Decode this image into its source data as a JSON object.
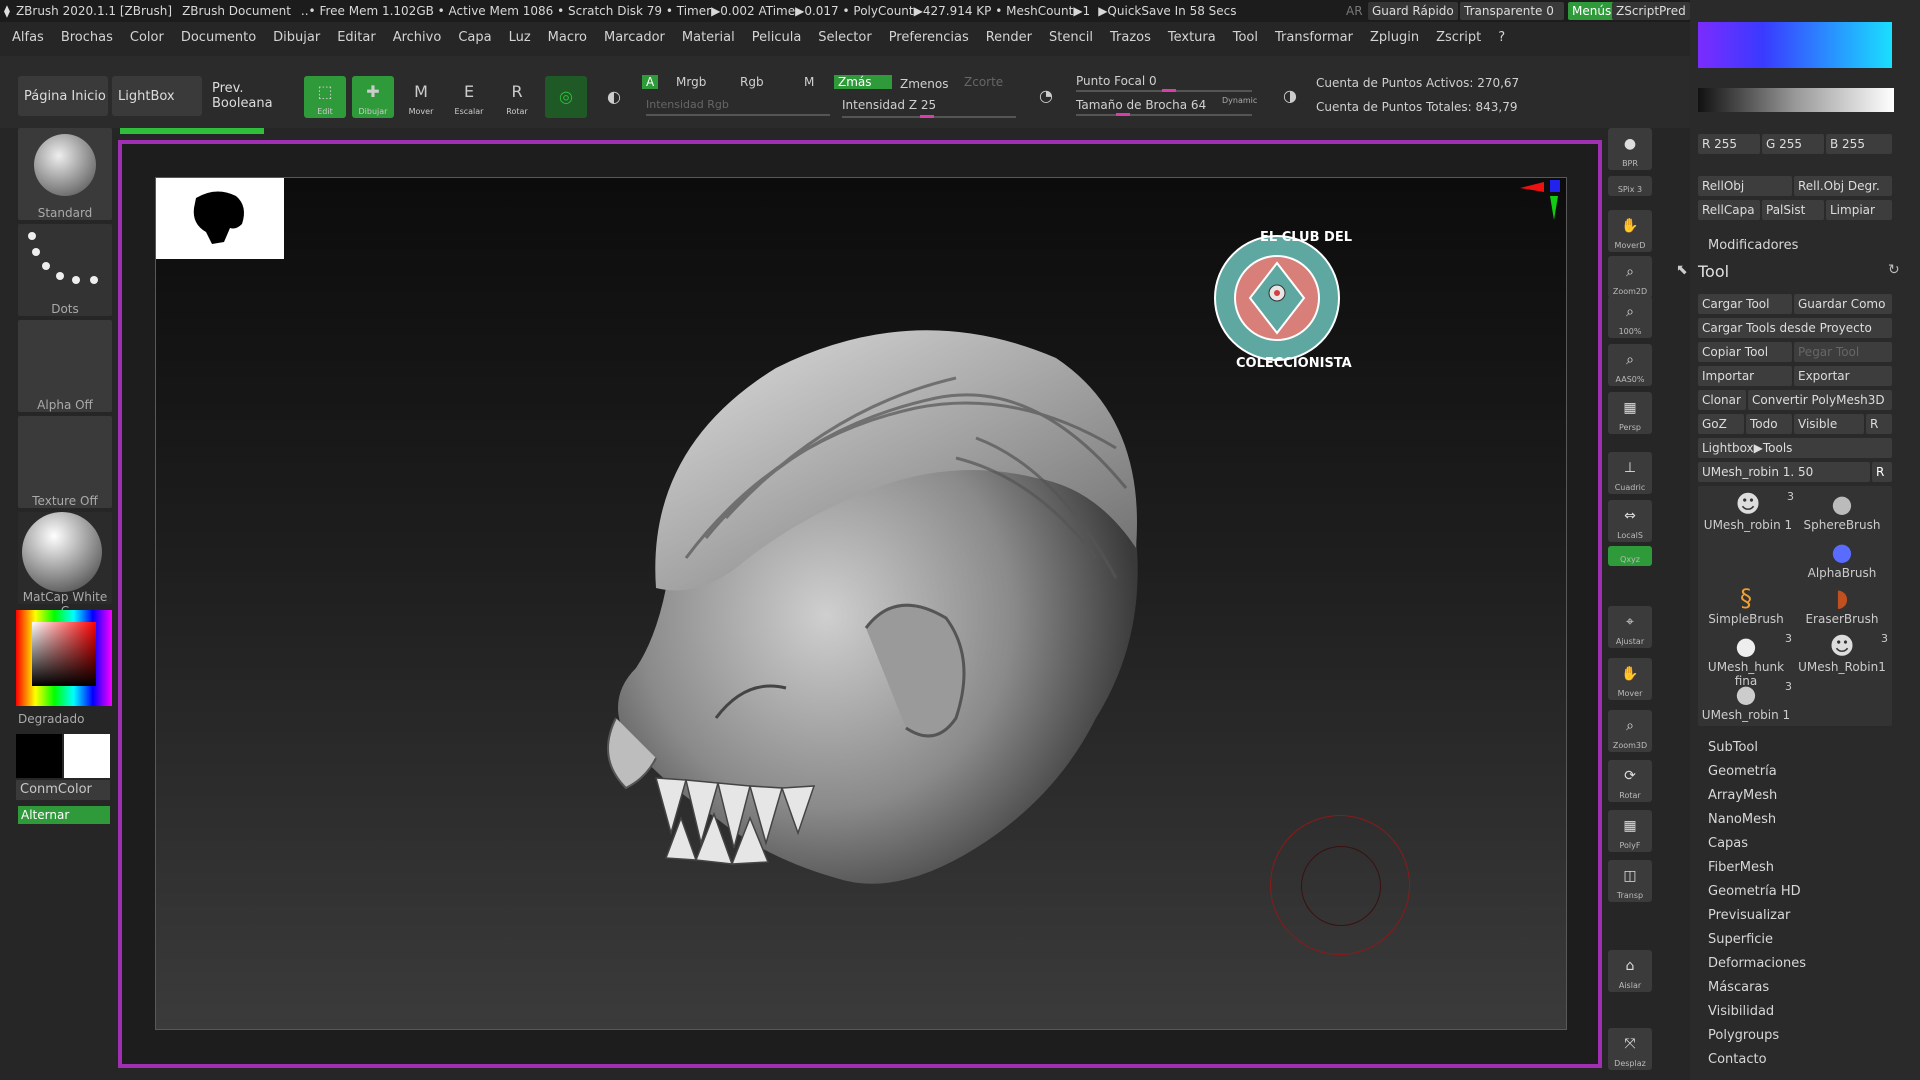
{
  "titlebar": {
    "logo_icon": "zbrush-logo",
    "app": "ZBrush 2020.1.1 [ZBrush]",
    "doc": "ZBrush Document",
    "stats": "..• Free Mem 1.102GB • Active Mem 1086 • Scratch Disk 79 • Timer▶0.002 ATime▶0.017 • PolyCount▶427.914 KP • MeshCount▶1",
    "quicksave": "▶QuickSave In 58 Secs",
    "ar": "AR",
    "guard_rapido": "Guard Rápido",
    "transparente": "Transparente 0",
    "menus": "Menús",
    "zscript": "ZScriptPred",
    "accent": "#2f9a3a"
  },
  "menu": [
    "Alfas",
    "Brochas",
    "Color",
    "Documento",
    "Dibujar",
    "Editar",
    "Archivo",
    "Capa",
    "Luz",
    "Macro",
    "Marcador",
    "Material",
    "Pelicula",
    "Selector",
    "Preferencias",
    "Render",
    "Stencil",
    "Trazos",
    "Textura",
    "Tool",
    "Transformar",
    "Zplugin",
    "Zscript",
    "?"
  ],
  "shelf": {
    "pagina_inicio": "Página Inicio",
    "lightbox": "LightBox",
    "prev_booleana": "Prev. Booleana",
    "edit": "Edit",
    "dibujar": "Dibujar",
    "mover": "Mover",
    "escalar": "Escalar",
    "rotar": "Rotar",
    "a": "A",
    "mrgb": "Mrgb",
    "rgb": "Rgb",
    "m": "M",
    "zmas": "Zmás",
    "zmenos": "Zmenos",
    "zcorte": "Zcorte",
    "intensidad_rgb": "Intensidad Rgb",
    "intensidad_z": "Intensidad Z 25",
    "punto_focal": "Punto Focal 0",
    "tamano_brocha": "Tamaño de Brocha 64",
    "dynamic": "Dynamic",
    "cuenta_activos": "Cuenta de Puntos Activos: 270,67",
    "cuenta_totales": "Cuenta de Puntos Totales: 843,79"
  },
  "left": {
    "standard": "Standard",
    "dots": "Dots",
    "alpha_off": "Alpha Off",
    "texture_off": "Texture Off",
    "matcap": "MatCap White C",
    "degradado": "Degradado",
    "conmcolor": "ConmColor",
    "alternar": "Alternar"
  },
  "canvas": {
    "logo_top": "EL CLUB DEL",
    "logo_bottom": "COLECCIONISTA",
    "logo_ring_color": "#5fa8a2",
    "logo_inner_color": "#d97f7a"
  },
  "rightshelf": [
    {
      "name": "bpr",
      "label": "BPR"
    },
    {
      "name": "spix",
      "label": "SPix 3"
    },
    {
      "name": "moverd",
      "label": "MoverD"
    },
    {
      "name": "zoom2d",
      "label": "Zoom2D"
    },
    {
      "name": "z100",
      "label": "100%"
    },
    {
      "name": "aahalf",
      "label": "AAS0%"
    },
    {
      "name": "persp",
      "label": "Persp"
    },
    {
      "name": "cuadric",
      "label": "Cuadric"
    },
    {
      "name": "locals",
      "label": "LocalS"
    },
    {
      "name": "xyz",
      "label": "Qxyz"
    },
    {
      "name": "ajustar",
      "label": "Ajustar"
    },
    {
      "name": "mover",
      "label": "Mover"
    },
    {
      "name": "zoom3d",
      "label": "Zoom3D"
    },
    {
      "name": "rotar",
      "label": "Rotar"
    },
    {
      "name": "polyf",
      "label": "PolyF"
    },
    {
      "name": "transp",
      "label": "Transp"
    },
    {
      "name": "aislar",
      "label": "Aislar"
    },
    {
      "name": "desplaz",
      "label": "Desplaz"
    }
  ],
  "rightpanel": {
    "r": "R 255",
    "g": "G 255",
    "b": "B 255",
    "rellobj": "RellObj",
    "rellobj_degr": "Rell.Obj Degr.",
    "rellcapa": "RellCapa",
    "palsist": "PalSist",
    "limpiar": "Limpiar",
    "modificadores": "Modificadores",
    "tool_title": "Tool",
    "cargar_tool": "Cargar Tool",
    "guardar_como": "Guardar Como",
    "cargar_proyecto": "Cargar Tools desde Proyecto",
    "copiar_tool": "Copiar Tool",
    "pegar_tool": "Pegar Tool",
    "importar": "Importar",
    "exportar": "Exportar",
    "clonar": "Clonar",
    "convertir": "Convertir PolyMesh3D",
    "goz": "GoZ",
    "todo": "Todo",
    "visible": "Visible",
    "r_btn": "R",
    "lightbox_tools": "Lightbox▶Tools",
    "current_tool": "UMesh_robin 1. 50",
    "tools": [
      {
        "label": "UMesh_robin 1",
        "count": "3"
      },
      {
        "label": "SphereBrush",
        "count": ""
      },
      {
        "label": "AlphaBrush",
        "count": ""
      },
      {
        "label": "SimpleBrush",
        "count": ""
      },
      {
        "label": "EraserBrush",
        "count": ""
      },
      {
        "label": "UMesh_hunk fina",
        "count": "3"
      },
      {
        "label": "UMesh_Robin1",
        "count": "3"
      },
      {
        "label": "UMesh_robin 1",
        "count": "3"
      }
    ],
    "sections": [
      "SubTool",
      "Geometría",
      "ArrayMesh",
      "NanoMesh",
      "Capas",
      "FiberMesh",
      "Geometría HD",
      "Previsualizar",
      "Superficie",
      "Deformaciones",
      "Máscaras",
      "Visibilidad",
      "Polygroups",
      "Contacto"
    ]
  }
}
